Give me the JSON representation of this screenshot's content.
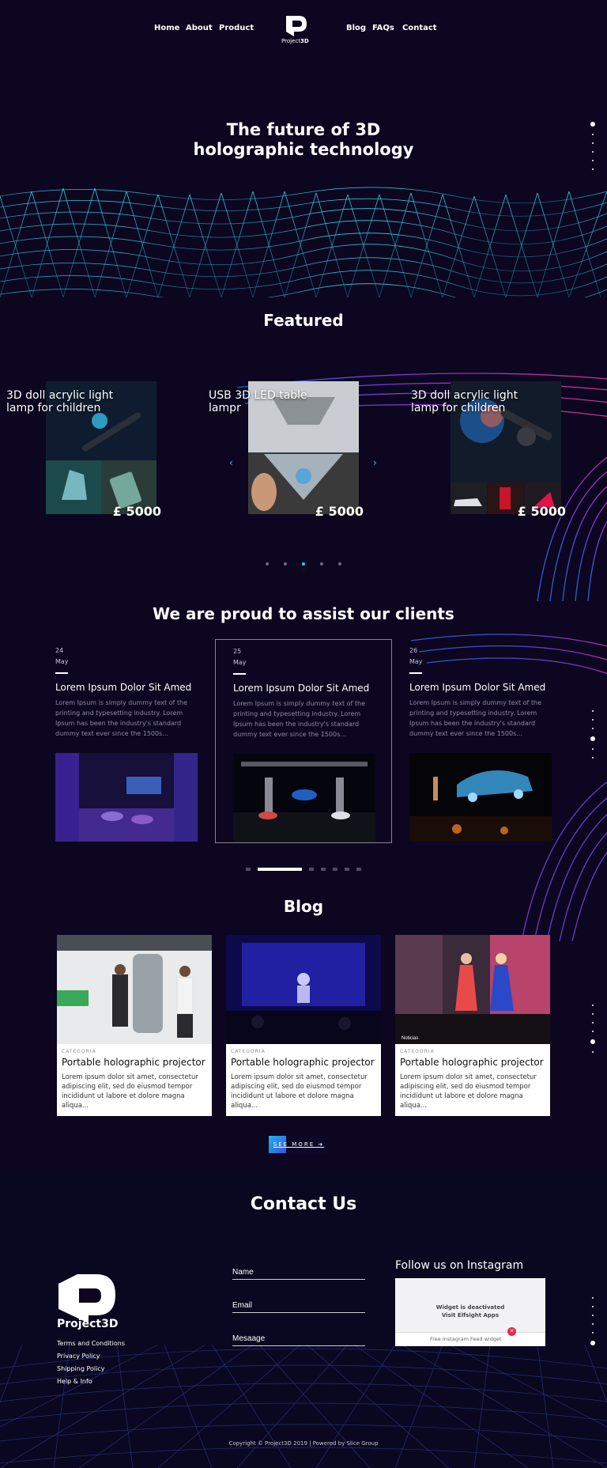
{
  "nav": {
    "links_left": [
      "Home",
      "About",
      "Product"
    ],
    "links_right": [
      "Blog",
      "FAQs",
      "Contact"
    ],
    "logo_text_a": "Project",
    "logo_text_b": "3D"
  },
  "hero": {
    "title_line1": "The future of 3D",
    "title_line2": "holographic technology"
  },
  "featured": {
    "title": "Featured",
    "products": [
      {
        "name": "3D doll acrylic light lamp for children",
        "price": "£ 5000"
      },
      {
        "name": "USB 3D LED table lampr",
        "price": "£ 5000"
      },
      {
        "name": "3D doll acrylic light lamp for children",
        "price": "£ 5000"
      }
    ],
    "prev_arrow": "‹",
    "next_arrow": "›",
    "dots": 5,
    "active_dot": 2
  },
  "clients": {
    "title": "We are proud to assist our clients",
    "events": [
      {
        "day": "24",
        "month": "May",
        "title": "Lorem Ipsum Dolor Sit Amed",
        "text": "Lorem Ipsum is simply dummy text of the printing and typesetting industry. Lorem Ipsum has been the industry's standard dummy text ever since the 1500s..."
      },
      {
        "day": "25",
        "month": "May",
        "title": "Lorem Ipsum Dolor Sit Amed",
        "text": "Lorem Ipsum is simply dummy text of the printing and typesetting industry. Lorem Ipsum has been the industry's standard dummy text ever since the 1500s..."
      },
      {
        "day": "26",
        "month": "May",
        "title": "Lorem Ipsum Dolor Sit Amed",
        "text": "Lorem Ipsum is simply dummy text of the printing and typesetting industry. Lorem Ipsum has been the industry's standard dummy text ever since the 1500s..."
      }
    ],
    "pager_count": 7,
    "active_index": 1
  },
  "blog": {
    "title": "Blog",
    "posts": [
      {
        "category": "CATEGORIA",
        "title": "Portable holographic projector",
        "text": "Lorem ipsum dolor sit amet, consectetur adipiscing elit, sed do eiusmod tempor incididunt ut labore et dolore magna aliqua..."
      },
      {
        "category": "CATEGORIA",
        "title": "Portable holographic projector",
        "text": "Lorem ipsum dolor sit amet, consectetur adipiscing elit, sed do eiusmod tempor incididunt ut labore et dolore magna aliqua..."
      },
      {
        "category": "CATEGORIA",
        "title": "Portable holographic projector",
        "text": "Lorem ipsum dolor sit amet, consectetur adipiscing elit, sed do eiusmod tempor incididunt ut labore et dolore magna aliqua..."
      }
    ],
    "see_more": "SEE MORE",
    "see_more_arrow": "➔",
    "watermark": "Noticias"
  },
  "contact": {
    "title": "Contact Us",
    "logo_text_a": "Project",
    "logo_text_b": "3D",
    "footer_links": [
      "Terms and Conditions",
      "Privacy Policy",
      "Shipping Policy",
      "Help & Info"
    ],
    "form": {
      "name_placeholder": "Name",
      "email_placeholder": "Email",
      "message_placeholder": "Mesaage"
    },
    "instagram": {
      "title": "Follow us on Instagram",
      "message_line1": "Widget is deactivated",
      "message_line2": "Visit Elfsight Apps",
      "footer": "Free Instagram Feed widget",
      "close": "✕"
    }
  },
  "footer": {
    "copyright": "Copyright © Project3D 2019 | Powered by Slice Group"
  },
  "colors": {
    "background": "#0c0620",
    "accent_cyan": "#1ed8e8",
    "accent_blue": "#3b4fd8",
    "accent_pink": "#e8264a"
  }
}
